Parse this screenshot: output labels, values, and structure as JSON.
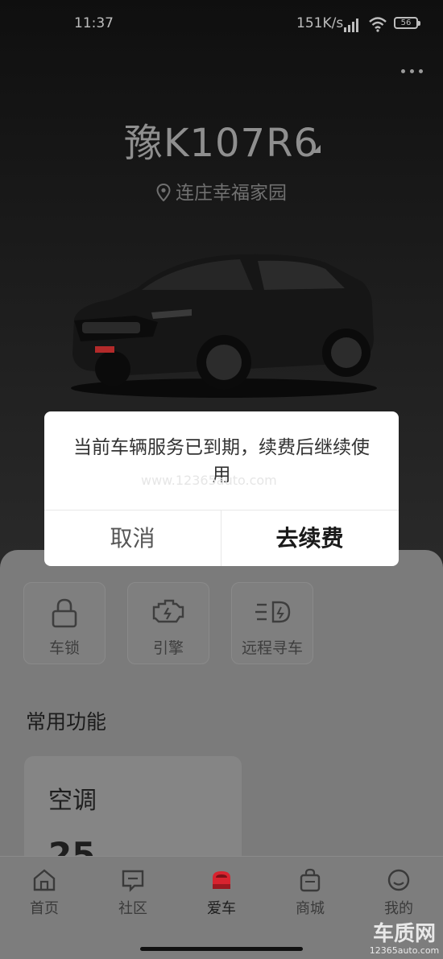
{
  "status_bar": {
    "time": "11:37",
    "speed": "151K/s",
    "battery": "56"
  },
  "vehicle": {
    "plate": "豫K107R6",
    "location": "连庄幸福家园"
  },
  "quick_actions": [
    {
      "label": "车锁",
      "icon": "lock-icon"
    },
    {
      "label": "引擎",
      "icon": "engine-icon"
    },
    {
      "label": "远程寻车",
      "icon": "headlight-icon"
    }
  ],
  "common_functions": {
    "title": "常用功能",
    "card": {
      "title": "空调",
      "value": "25"
    }
  },
  "tabs": [
    {
      "label": "首页",
      "icon": "home-icon"
    },
    {
      "label": "社区",
      "icon": "chat-icon"
    },
    {
      "label": "爱车",
      "icon": "car-icon",
      "active": true
    },
    {
      "label": "商城",
      "icon": "bag-icon"
    },
    {
      "label": "我的",
      "icon": "profile-icon"
    }
  ],
  "dialog": {
    "message": "当前车辆服务已到期，续费后继续使用",
    "watermark": "www.12365auto.com",
    "cancel_label": "取消",
    "confirm_label": "去续费"
  },
  "watermark": {
    "main": "车质网",
    "sub": "12365auto.com"
  },
  "colors": {
    "accent": "#d8232f",
    "dialog_bg": "#ffffff"
  }
}
